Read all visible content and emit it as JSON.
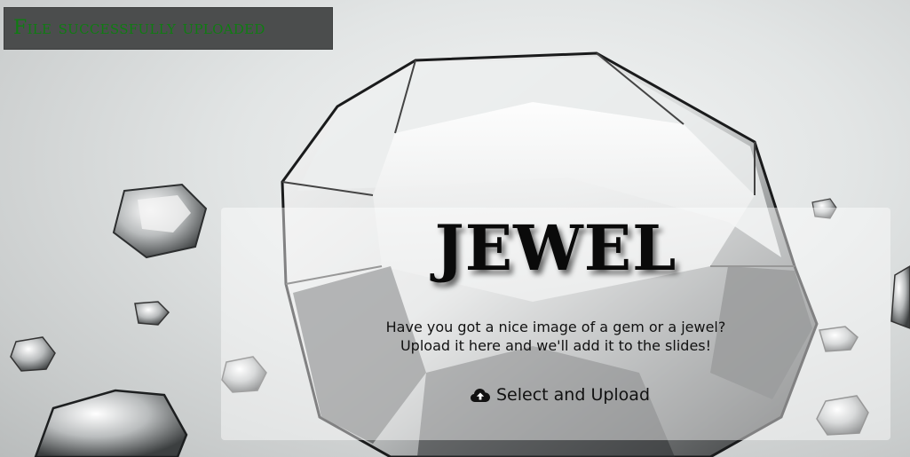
{
  "toast": {
    "message": "File successfully uploaded"
  },
  "card": {
    "title": "JEWEL",
    "line1": "Have you got a nice image of a gem or a jewel?",
    "line2": "Upload it here and we'll add it to the slides!",
    "upload_label": "Select and Upload",
    "upload_icon": "cloud-upload-icon"
  },
  "colors": {
    "toast_bg": "#4b4d4d",
    "toast_text": "#0f7d12",
    "card_bg": "rgba(255,255,255,0.45)",
    "title": "#0a0a0a"
  }
}
